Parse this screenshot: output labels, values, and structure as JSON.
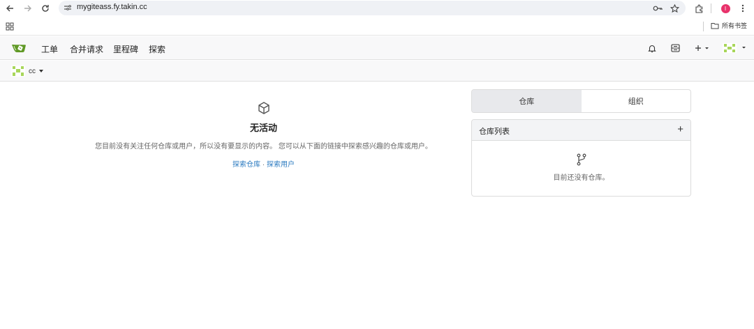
{
  "browser": {
    "url": "mygiteass.fy.takin.cc",
    "profile_initial": "I",
    "bookmarks_folder": "所有书签"
  },
  "nav": {
    "items": [
      "工单",
      "合并请求",
      "里程碑",
      "探索"
    ]
  },
  "context": {
    "user": "cc"
  },
  "feed": {
    "title": "无活动",
    "description": "您目前没有关注任何仓库或用户，所以没有要显示的内容。 您可以从下面的链接中探索感兴趣的仓库或用户。",
    "link_repos": "探索仓库",
    "link_sep": "·",
    "link_users": "探索用户"
  },
  "sidebar": {
    "tabs": [
      "仓库",
      "组织"
    ],
    "repo_list_title": "仓库列表",
    "add_symbol": "+",
    "empty_text": "目前还没有仓库。"
  },
  "colors": {
    "accent": "#609926",
    "link": "#2a7ac0",
    "profile": "#e8326b"
  }
}
